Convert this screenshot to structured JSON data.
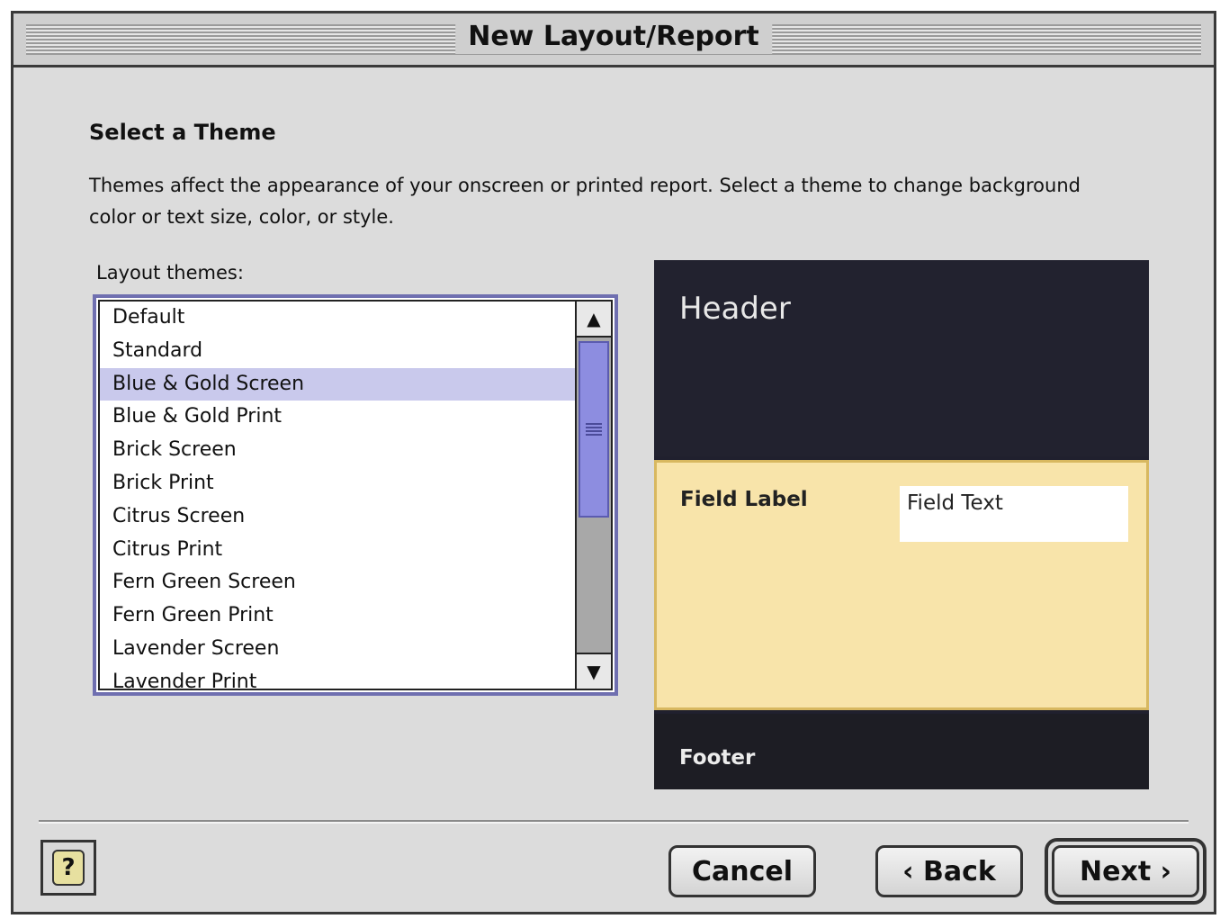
{
  "window": {
    "title": "New Layout/Report"
  },
  "content": {
    "heading": "Select a Theme",
    "description": "Themes affect the appearance of your onscreen or printed report.  Select a theme to change background color or text size, color, or style."
  },
  "themes": {
    "label": "Layout themes:",
    "items": [
      "Default",
      "Standard",
      "Blue & Gold Screen",
      "Blue & Gold Print",
      "Brick Screen",
      "Brick Print",
      "Citrus Screen",
      "Citrus Print",
      "Fern Green Screen",
      "Fern Green Print",
      "Lavender Screen",
      "Lavender Print"
    ],
    "selected_index": 2,
    "scroll_position": 0.0
  },
  "preview": {
    "header": "Header",
    "field_label": "Field Label",
    "field_text": "Field Text",
    "footer": "Footer",
    "colors": {
      "header_bg": "#22222f",
      "body_bg": "#f8e4aa",
      "footer_bg": "#1d1d24"
    }
  },
  "buttons": {
    "help_glyph": "?",
    "help_icon": "help-icon",
    "cancel": "Cancel",
    "back": "‹ Back",
    "next": "Next ›"
  },
  "colors": {
    "selection": "#c9c9ec",
    "scroll_thumb": "#8d8de0",
    "list_border": "#6f6fb0"
  }
}
